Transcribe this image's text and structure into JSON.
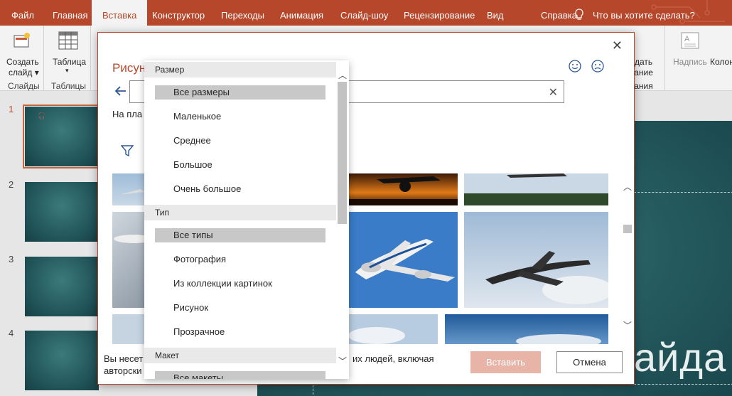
{
  "menu": {
    "items": [
      "Файл",
      "Главная",
      "Вставка",
      "Конструктор",
      "Переходы",
      "Анимация",
      "Слайд-шоу",
      "Рецензирование",
      "Вид",
      "Справка"
    ],
    "tell_me": "Что вы хотите сделать?"
  },
  "ribbon": {
    "new_slide_line1": "Создать",
    "new_slide_line2": "слайд ▾",
    "slides_group": "Слайды",
    "table": "Таблица",
    "tables_group": "Таблицы",
    "right_partial1": "дать",
    "right_partial2": "чание",
    "right_partial3": "чания",
    "caption": "Надпись",
    "columns": "Колон"
  },
  "thumbnails": [
    "1",
    "2",
    "3",
    "4"
  ],
  "slide": {
    "text": "айда"
  },
  "dialog": {
    "title": "Рисун",
    "on_plan": "На пла",
    "footer_line1": "Вы несет",
    "footer_line1b": "их людей, включая",
    "footer_line2": "авторски",
    "insert": "Вставить",
    "cancel": "Отмена"
  },
  "dropdown": {
    "size_header": "Размер",
    "size_items": [
      "Все размеры",
      "Маленькое",
      "Среднее",
      "Большое",
      "Очень большое"
    ],
    "type_header": "Тип",
    "type_items": [
      "Все типы",
      "Фотография",
      "Из коллекции картинок",
      "Рисунок",
      "Прозрачное"
    ],
    "layout_header": "Макет",
    "layout_items": [
      "Все макеты"
    ]
  },
  "colors": {
    "accent": "#b7472a",
    "insert_disabled": "#e8b4a8",
    "slide_bg": "#245a5e"
  }
}
